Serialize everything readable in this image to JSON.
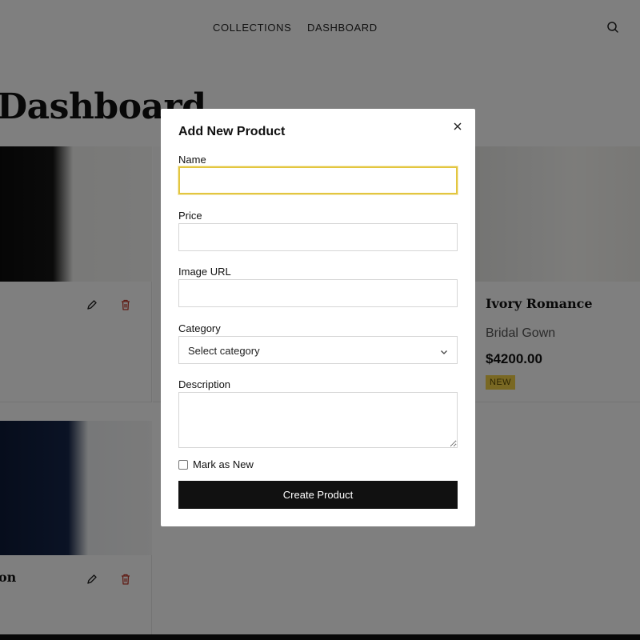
{
  "nav": {
    "links": [
      "COLLECTIONS",
      "DASHBOARD"
    ],
    "search_icon": "search-icon"
  },
  "page": {
    "title": "Dashboard"
  },
  "products": [
    {
      "name": "",
      "category": "",
      "price": "",
      "badge": "",
      "edit_icon": "pencil-icon",
      "delete_icon": "trash-icon"
    },
    {
      "name": "Ivory Romance",
      "category": "Bridal Gown",
      "price": "$4200.00",
      "badge": "NEW"
    },
    {
      "name": "on",
      "edit_icon": "pencil-icon",
      "delete_icon": "trash-icon"
    }
  ],
  "colors": {
    "accent": "#e3c640",
    "badge_bg": "#f3d046",
    "primary_button": "#111111",
    "delete_icon": "#c0392b",
    "overlay": "rgba(0,0,0,0.5)"
  },
  "modal": {
    "title": "Add New Product",
    "close_icon": "close-icon",
    "fields": {
      "name": {
        "label": "Name",
        "value": ""
      },
      "price": {
        "label": "Price",
        "value": ""
      },
      "image_url": {
        "label": "Image URL",
        "value": ""
      },
      "category": {
        "label": "Category",
        "selected": "Select category"
      },
      "description": {
        "label": "Description",
        "value": ""
      }
    },
    "mark_new_label": "Mark as New",
    "submit_label": "Create Product"
  }
}
